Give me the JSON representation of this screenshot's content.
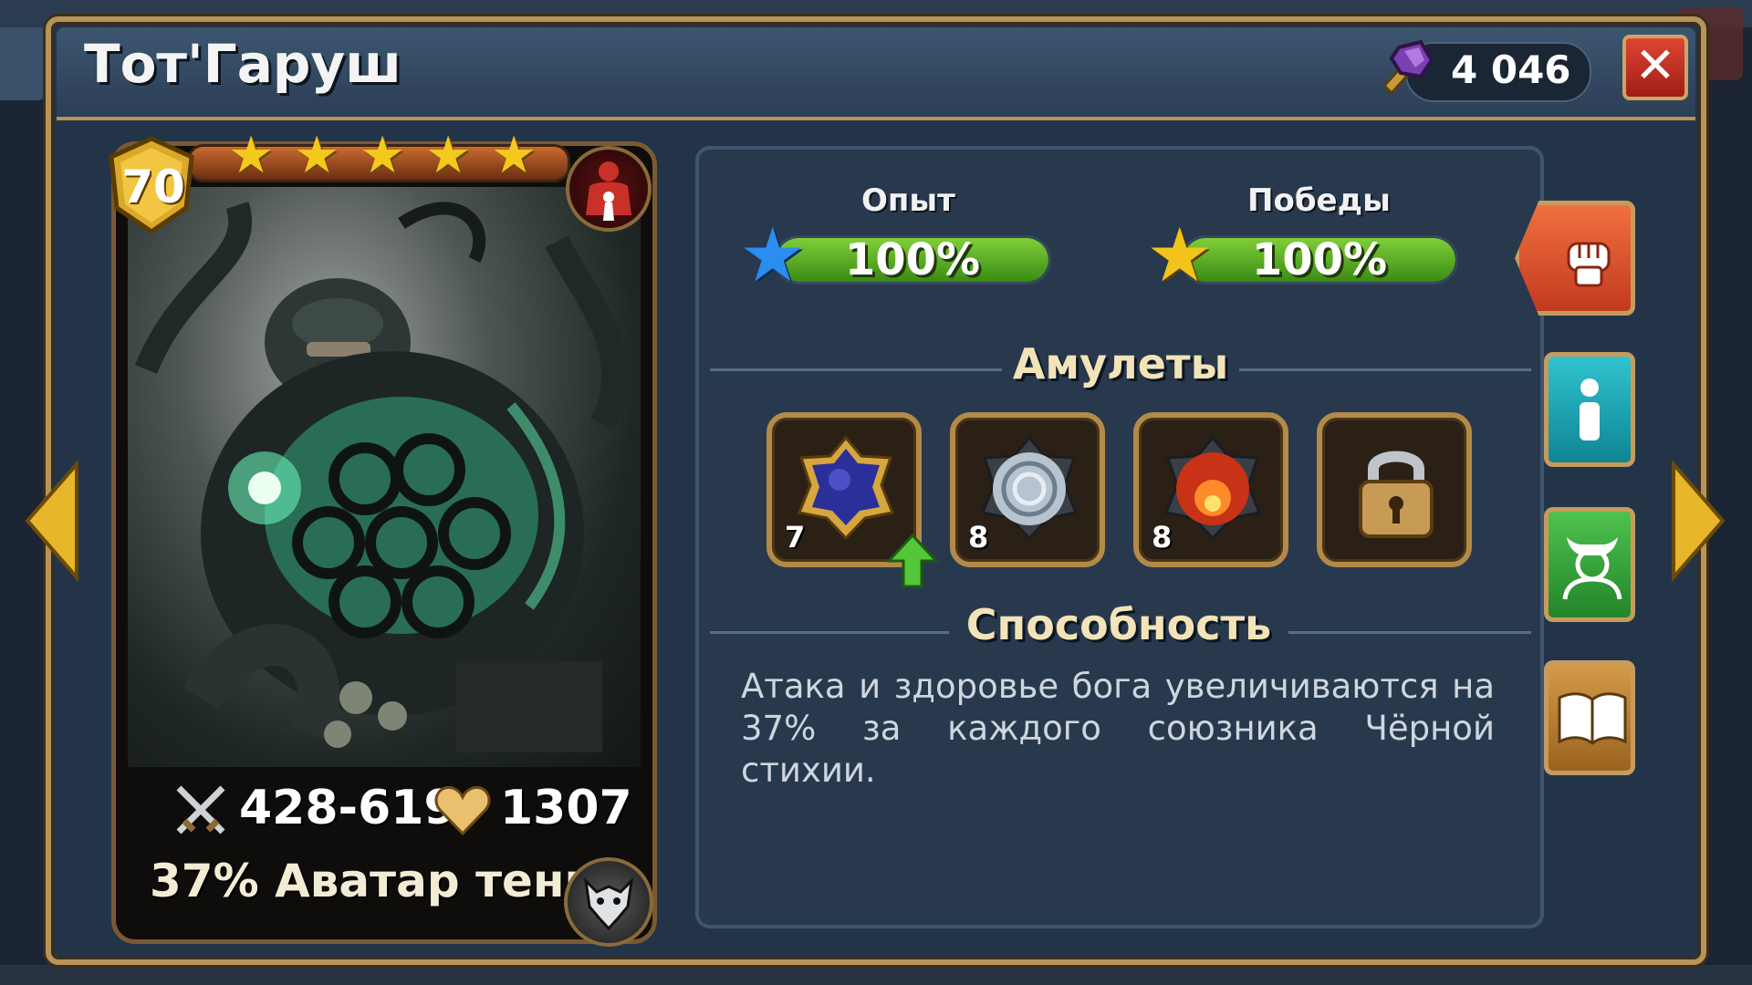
{
  "window": {
    "title": "Тот'Гаруш"
  },
  "currency": {
    "value": "4 046",
    "icon": "purple-hammer-crystal-icon"
  },
  "card": {
    "level": "70",
    "stars": 5,
    "attack": "428-619",
    "health": "1307",
    "ability_summary": "37% Аватар тени",
    "class_icon": "red-giant-class-icon",
    "element_icon": "shadow-beast-element-icon"
  },
  "stats": {
    "experience": {
      "label": "Опыт",
      "value": "100%",
      "fill": 1.0,
      "star_color": "#2a8df0"
    },
    "victories": {
      "label": "Победы",
      "value": "100%",
      "fill": 1.0,
      "star_color": "#f2c31a"
    }
  },
  "amulets": {
    "title": "Амулеты",
    "slots": [
      {
        "name": "dark-blue-amulet",
        "level": "7",
        "color": "#2b2f9a",
        "upgradable": true
      },
      {
        "name": "silver-swirl-amulet",
        "level": "8",
        "color": "#b7c3cf",
        "upgradable": false
      },
      {
        "name": "red-fire-amulet",
        "level": "8",
        "color": "#c83216",
        "upgradable": false
      },
      {
        "name": "locked-slot",
        "level": "",
        "locked": true
      }
    ]
  },
  "ability": {
    "title": "Способность",
    "description": "Атака и здоровье бога увеличиваются на 37% за каждого союзника Чёрной стихии."
  },
  "side_buttons": [
    {
      "name": "fist-button",
      "icon": "fist-icon",
      "color": "#e05534"
    },
    {
      "name": "info-button",
      "icon": "info-icon",
      "color": "#19a9b8"
    },
    {
      "name": "evolve-button",
      "icon": "horned-head-icon",
      "color": "#3aa33a"
    },
    {
      "name": "lore-button",
      "icon": "book-icon",
      "color": "#b78336"
    }
  ]
}
